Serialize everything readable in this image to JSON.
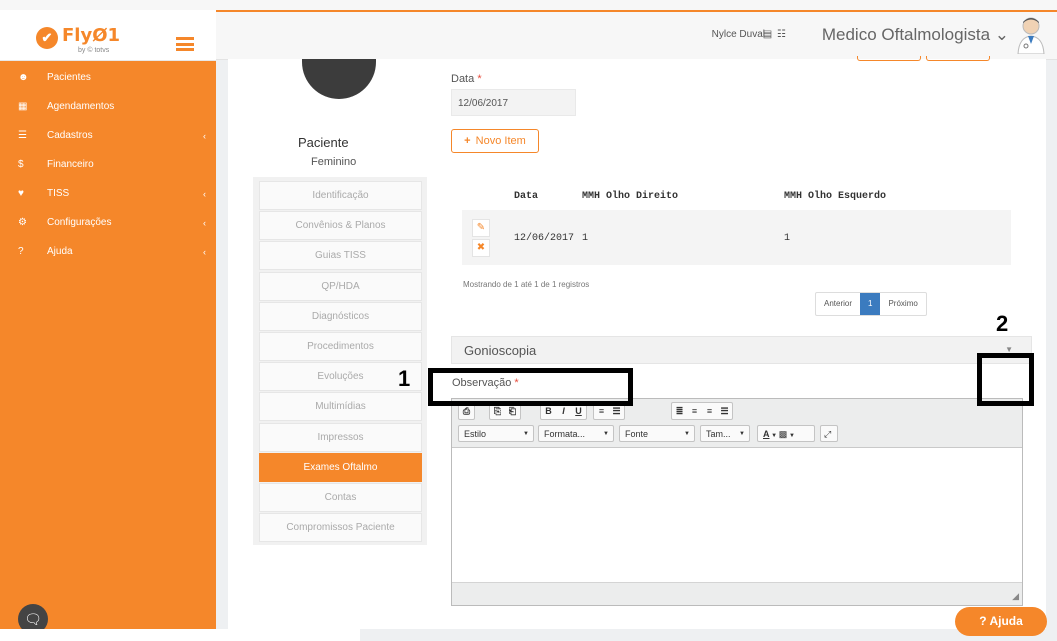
{
  "app": {
    "logo_text": "FlyØ1",
    "logo_sub": "by © totvs",
    "menu_icon": "hamburger-icon"
  },
  "sidebar": {
    "items": [
      {
        "label": "Pacientes",
        "icon": "users-icon",
        "glyph": "☻",
        "caret": ""
      },
      {
        "label": "Agendamentos",
        "icon": "calendar-icon",
        "glyph": "▦",
        "caret": ""
      },
      {
        "label": "Cadastros",
        "icon": "list-icon",
        "glyph": "☰",
        "caret": "‹"
      },
      {
        "label": "Financeiro",
        "icon": "dollar-icon",
        "glyph": "$",
        "caret": ""
      },
      {
        "label": "TISS",
        "icon": "handshake-icon",
        "glyph": "♥",
        "caret": "‹"
      },
      {
        "label": "Configurações",
        "icon": "gear-icon",
        "glyph": "⚙",
        "caret": "‹"
      },
      {
        "label": "Ajuda",
        "icon": "question-icon",
        "glyph": "?",
        "caret": "‹"
      }
    ],
    "chat_icon": "chat-icon"
  },
  "header": {
    "user_name": "Nylce Duval",
    "icons": "▤ ☷",
    "role": "Medico Oftalmologista ⌄",
    "avatar": "doctor-avatar"
  },
  "patient": {
    "title": "Paciente",
    "gender": "Feminino"
  },
  "tabs": [
    {
      "label": "Identificação",
      "active": false
    },
    {
      "label": "Convênios & Planos",
      "active": false
    },
    {
      "label": "Guias TISS",
      "active": false
    },
    {
      "label": "QP/HDA",
      "active": false
    },
    {
      "label": "Diagnósticos",
      "active": false
    },
    {
      "label": "Procedimentos",
      "active": false
    },
    {
      "label": "Evoluções",
      "active": false
    },
    {
      "label": "Multimídias",
      "active": false
    },
    {
      "label": "Impressos",
      "active": false
    },
    {
      "label": "Exames Oftalmo",
      "active": true
    },
    {
      "label": "Contas",
      "active": false
    },
    {
      "label": "Compromissos Paciente",
      "active": false
    }
  ],
  "form": {
    "date_label": "Data",
    "required_mark": "*",
    "date_value": "12/06/2017",
    "new_item_label": "Novo Item",
    "new_item_plus": "+"
  },
  "table": {
    "headers": [
      "Data",
      "MMH Olho Direito",
      "MMH Olho Esquerdo"
    ],
    "rows": [
      {
        "data": "12/06/2017",
        "direito": "1",
        "esquerdo": "1"
      }
    ],
    "edit_icon": "✎",
    "delete_icon": "✖",
    "info": "Mostrando de 1 até 1 de 1 registros",
    "pagination": {
      "prev": "Anterior",
      "current": "1",
      "next": "Próximo"
    }
  },
  "section": {
    "title": "Gonioscopia",
    "caret": "▼"
  },
  "observacao": {
    "label": "Observação",
    "required_mark": "*"
  },
  "editor": {
    "toolbar_groups": [
      [
        "⎙"
      ],
      [
        "⎘",
        "⎗"
      ],
      [
        "B",
        "I",
        "U"
      ],
      [
        "≡",
        "☰"
      ],
      [
        "≣",
        "≡",
        "≡",
        "☰"
      ]
    ],
    "selects": [
      "Estilo",
      "Formata...",
      "Fonte",
      "Tam..."
    ],
    "color_buttons": [
      "A",
      "▩"
    ],
    "maximize": "⤢",
    "resize_glyph": "◢"
  },
  "annotations": {
    "one": "1",
    "two": "2"
  },
  "help": {
    "label": "Ajuda",
    "glyph": "?"
  },
  "colors": {
    "brand_orange": "#f5872a",
    "pagination_blue": "#3b7bbf",
    "required_red": "#e74c3c"
  }
}
